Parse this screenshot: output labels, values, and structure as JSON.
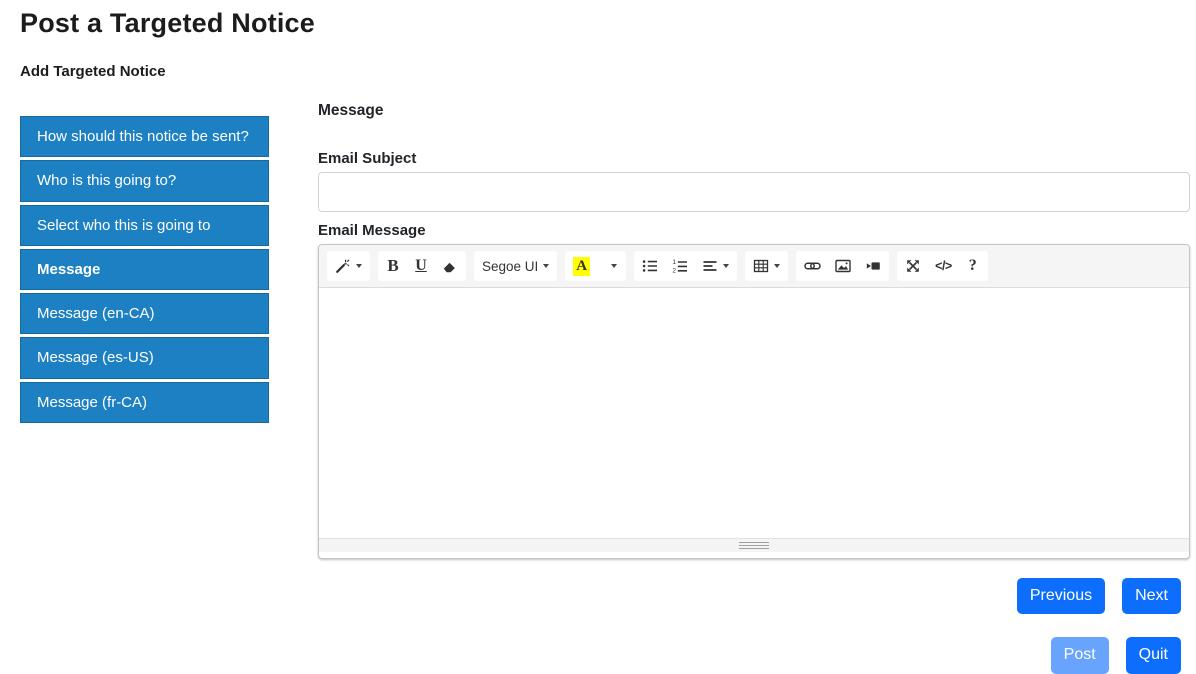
{
  "page": {
    "title": "Post a Targeted Notice",
    "subtitle": "Add Targeted Notice"
  },
  "sidebar": {
    "items": [
      {
        "label": "How should this notice be sent?",
        "active": false
      },
      {
        "label": "Who is this going to?",
        "active": false
      },
      {
        "label": "Select who this is going to",
        "active": false
      },
      {
        "label": "Message",
        "active": true
      },
      {
        "label": "Message (en-CA)",
        "active": false
      },
      {
        "label": "Message (es-US)",
        "active": false
      },
      {
        "label": "Message (fr-CA)",
        "active": false
      }
    ]
  },
  "main": {
    "section_title": "Message",
    "email_subject": {
      "label": "Email Subject",
      "value": ""
    },
    "email_message": {
      "label": "Email Message",
      "value": ""
    },
    "editor": {
      "font_name": "Segoe UI",
      "bold_glyph": "B",
      "underline_glyph": "U",
      "color_glyph": "A",
      "codeview_glyph": "</>",
      "help_glyph": "?"
    },
    "buttons": {
      "previous": "Previous",
      "next": "Next",
      "post": "Post",
      "quit": "Quit"
    },
    "post_button_disabled": true
  },
  "colors": {
    "sidebar_item": "#1d80c3",
    "primary_button": "#0d6efd",
    "highlight_yellow": "#ffff00"
  }
}
